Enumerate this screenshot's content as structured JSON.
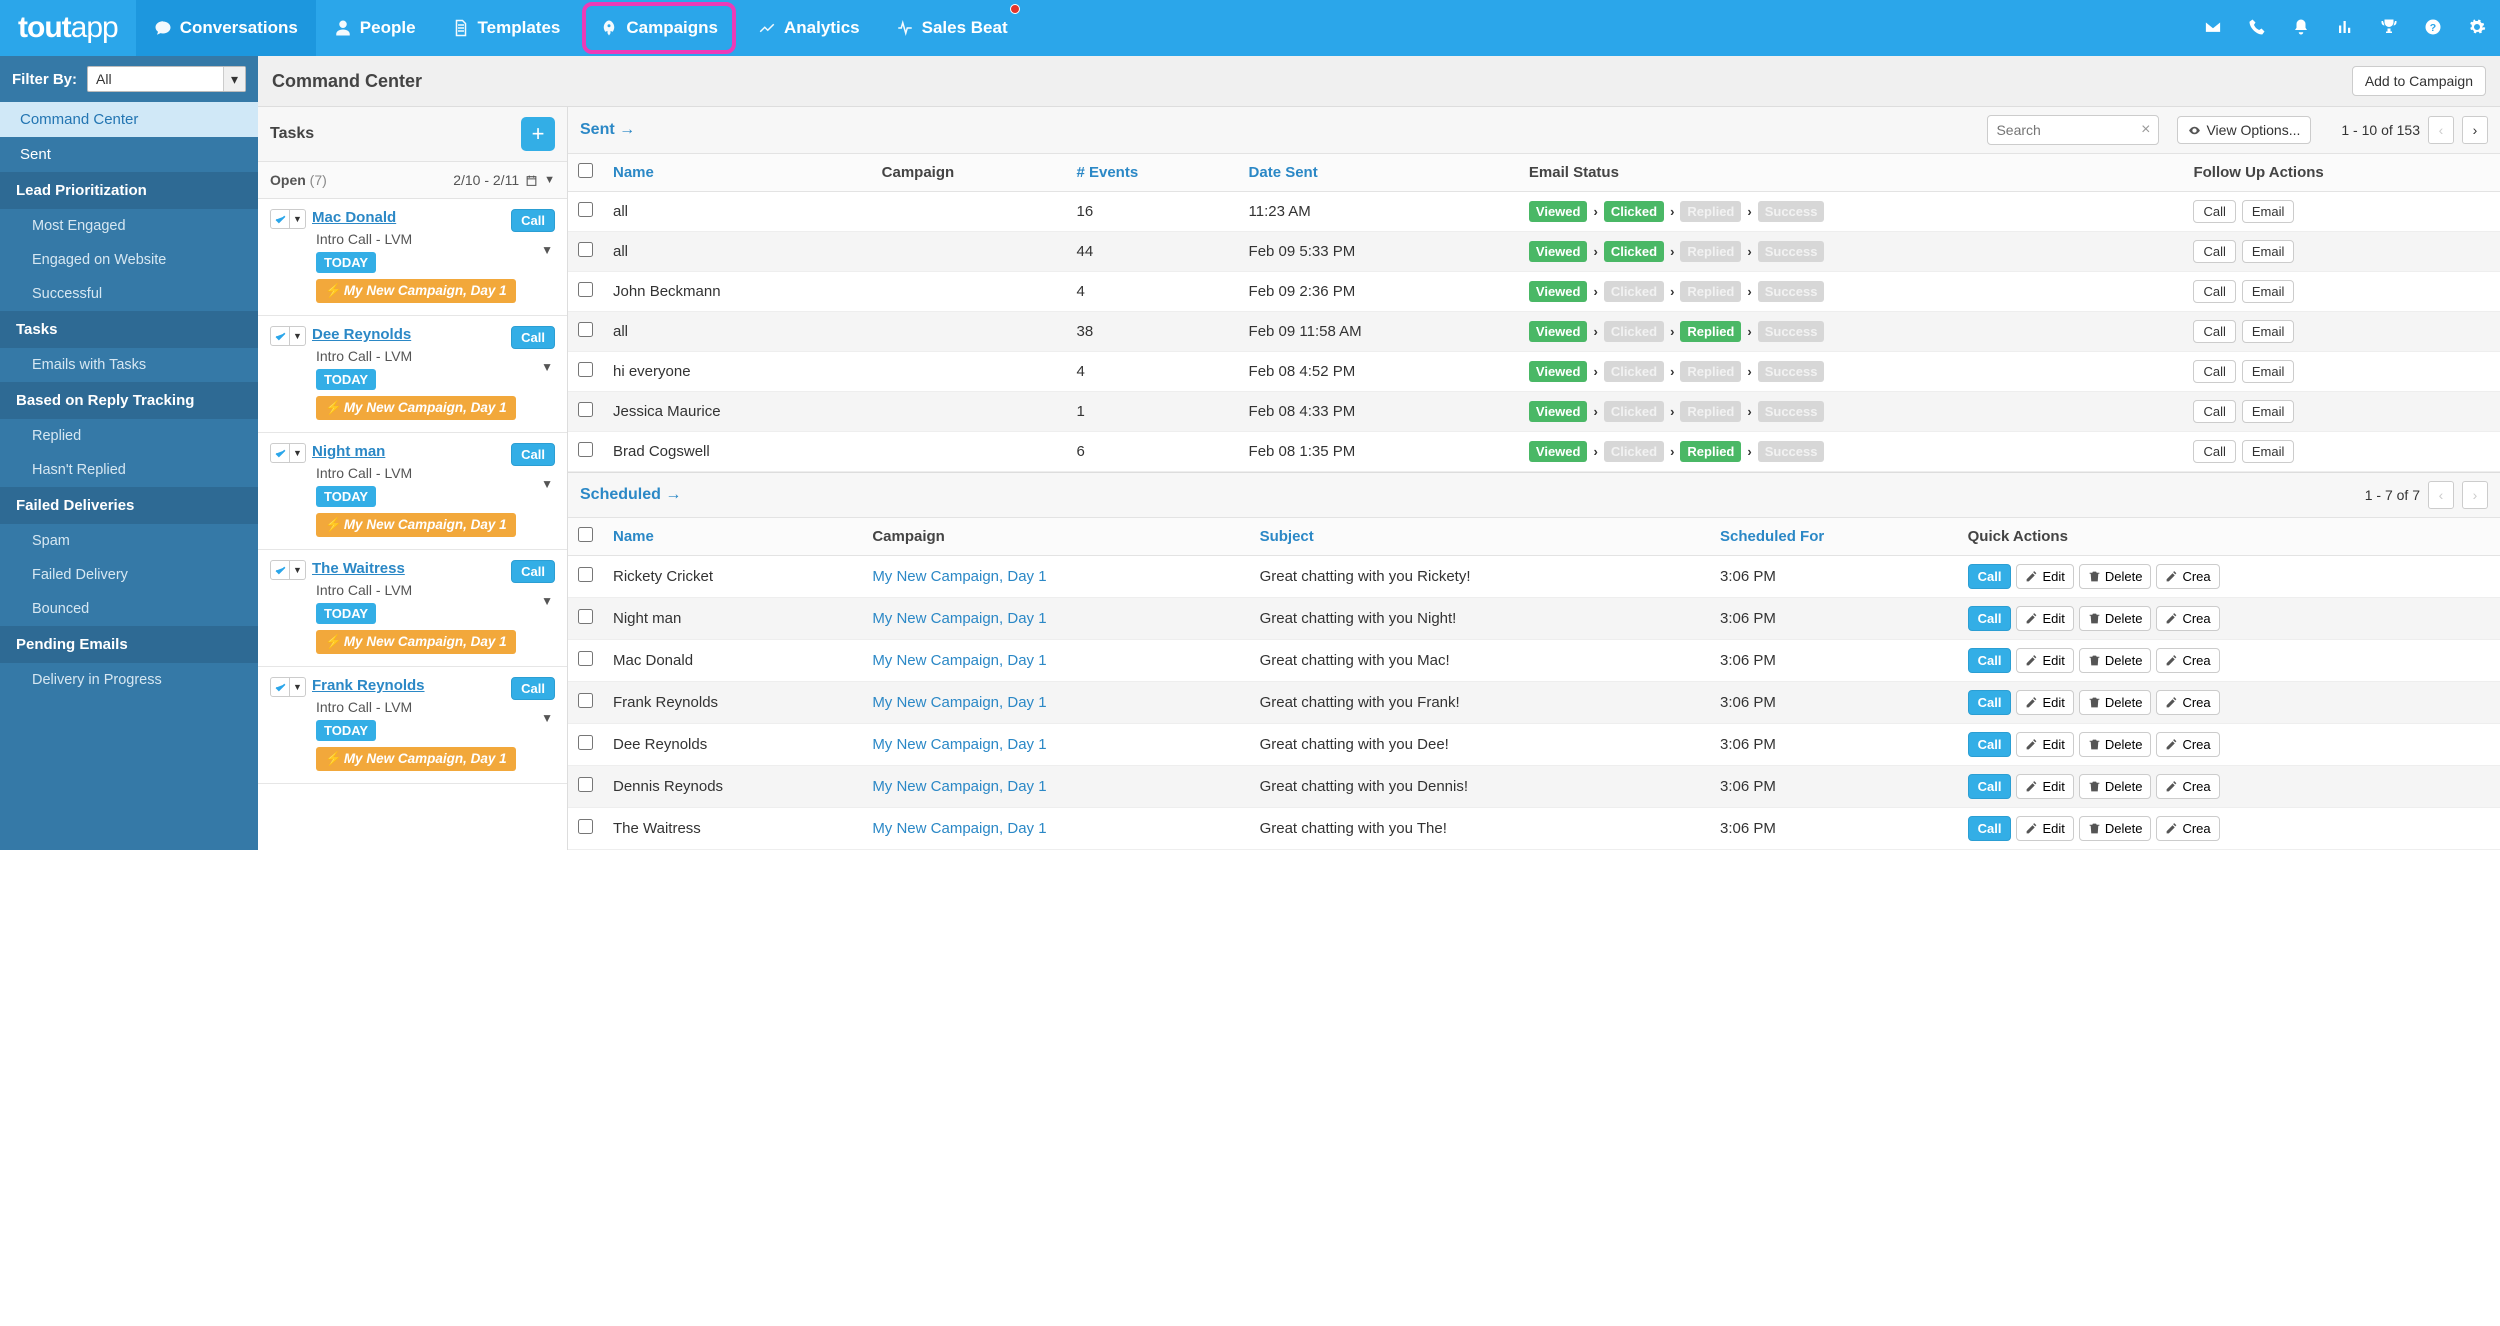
{
  "brand": {
    "pre": "tout",
    "post": "app"
  },
  "nav": [
    {
      "label": "Conversations",
      "active": true,
      "icon": "comment"
    },
    {
      "label": "People",
      "icon": "user"
    },
    {
      "label": "Templates",
      "icon": "file"
    },
    {
      "label": "Campaigns",
      "highlight": true,
      "icon": "rocket"
    },
    {
      "label": "Analytics",
      "icon": "trend"
    },
    {
      "label": "Sales Beat",
      "badge": true,
      "icon": "pulse"
    }
  ],
  "header_icons": [
    "envelope",
    "phone",
    "bell",
    "chart",
    "trophy",
    "help",
    "gear"
  ],
  "filter": {
    "label": "Filter By:",
    "value": "All"
  },
  "sidebar": [
    {
      "type": "item",
      "label": "Command Center",
      "active": true
    },
    {
      "type": "item",
      "label": "Sent"
    },
    {
      "type": "header",
      "label": "Lead Prioritization"
    },
    {
      "type": "sub",
      "label": "Most Engaged"
    },
    {
      "type": "sub",
      "label": "Engaged on Website"
    },
    {
      "type": "sub",
      "label": "Successful"
    },
    {
      "type": "header",
      "label": "Tasks"
    },
    {
      "type": "sub",
      "label": "Emails with Tasks"
    },
    {
      "type": "header",
      "label": "Based on Reply Tracking"
    },
    {
      "type": "sub",
      "label": "Replied"
    },
    {
      "type": "sub",
      "label": "Hasn't Replied"
    },
    {
      "type": "header",
      "label": "Failed Deliveries"
    },
    {
      "type": "sub",
      "label": "Spam"
    },
    {
      "type": "sub",
      "label": "Failed Delivery"
    },
    {
      "type": "sub",
      "label": "Bounced"
    },
    {
      "type": "header",
      "label": "Pending Emails"
    },
    {
      "type": "sub",
      "label": "Delivery in Progress"
    }
  ],
  "cc": {
    "title": "Command Center",
    "add_btn": "Add to Campaign"
  },
  "tasks": {
    "title": "Tasks",
    "open_label": "Open",
    "open_count": "(7)",
    "date_range": "2/10 - 2/11",
    "call_label": "Call",
    "today": "TODAY",
    "campaign": "My New Campaign, Day 1",
    "items": [
      {
        "name": "Mac Donald",
        "sub": "Intro Call - LVM"
      },
      {
        "name": "Dee Reynolds",
        "sub": "Intro Call - LVM"
      },
      {
        "name": "Night man",
        "sub": "Intro Call - LVM"
      },
      {
        "name": "The Waitress",
        "sub": "Intro Call - LVM"
      },
      {
        "name": "Frank Reynolds",
        "sub": "Intro Call - LVM"
      }
    ]
  },
  "sent": {
    "title": "Sent →",
    "search_placeholder": "Search",
    "view_options": "View Options...",
    "pager": "1 - 10 of 153",
    "cols": {
      "name": "Name",
      "campaign": "Campaign",
      "events": "# Events",
      "date": "Date Sent",
      "status": "Email Status",
      "follow": "Follow Up Actions"
    },
    "stat_labels": {
      "viewed": "Viewed",
      "clicked": "Clicked",
      "replied": "Replied",
      "success": "Success"
    },
    "follow_call": "Call",
    "follow_email": "Email",
    "rows": [
      {
        "name": "all",
        "events": "16",
        "date": "11:23 AM",
        "status": [
          "g",
          "g",
          "x",
          "x"
        ]
      },
      {
        "name": "all",
        "events": "44",
        "date": "Feb 09 5:33 PM",
        "status": [
          "g",
          "g",
          "x",
          "x"
        ],
        "alt": true
      },
      {
        "name": "John Beckmann",
        "events": "4",
        "date": "Feb 09 2:36 PM",
        "status": [
          "g",
          "x",
          "x",
          "x"
        ]
      },
      {
        "name": "all",
        "events": "38",
        "date": "Feb 09 11:58 AM",
        "status": [
          "g",
          "x",
          "g",
          "x"
        ],
        "alt": true
      },
      {
        "name": "hi everyone",
        "events": "4",
        "date": "Feb 08 4:52 PM",
        "status": [
          "g",
          "x",
          "x",
          "x"
        ]
      },
      {
        "name": "Jessica Maurice",
        "events": "1",
        "date": "Feb 08 4:33 PM",
        "status": [
          "g",
          "x",
          "x",
          "x"
        ],
        "alt": true
      },
      {
        "name": "Brad Cogswell",
        "events": "6",
        "date": "Feb 08 1:35 PM",
        "status": [
          "g",
          "x",
          "g",
          "x"
        ]
      }
    ]
  },
  "scheduled": {
    "title": "Scheduled →",
    "pager": "1 - 7 of 7",
    "cols": {
      "name": "Name",
      "campaign": "Campaign",
      "subject": "Subject",
      "when": "Scheduled For",
      "quick": "Quick Actions"
    },
    "campaign_text": "My New Campaign, Day 1",
    "qa": {
      "call": "Call",
      "edit": "Edit",
      "delete": "Delete",
      "create": "Crea"
    },
    "rows": [
      {
        "name": "Rickety Cricket",
        "subject": "Great chatting with you Rickety!",
        "when": "3:06 PM"
      },
      {
        "name": "Night man",
        "subject": "Great chatting with you Night!",
        "when": "3:06 PM",
        "alt": true
      },
      {
        "name": "Mac Donald",
        "subject": "Great chatting with you Mac!",
        "when": "3:06 PM"
      },
      {
        "name": "Frank Reynolds",
        "subject": "Great chatting with you Frank!",
        "when": "3:06 PM",
        "alt": true
      },
      {
        "name": "Dee Reynolds",
        "subject": "Great chatting with you Dee!",
        "when": "3:06 PM"
      },
      {
        "name": "Dennis Reynods",
        "subject": "Great chatting with you Dennis!",
        "when": "3:06 PM",
        "alt": true
      },
      {
        "name": "The Waitress",
        "subject": "Great chatting with you The!",
        "when": "3:06 PM"
      }
    ]
  }
}
